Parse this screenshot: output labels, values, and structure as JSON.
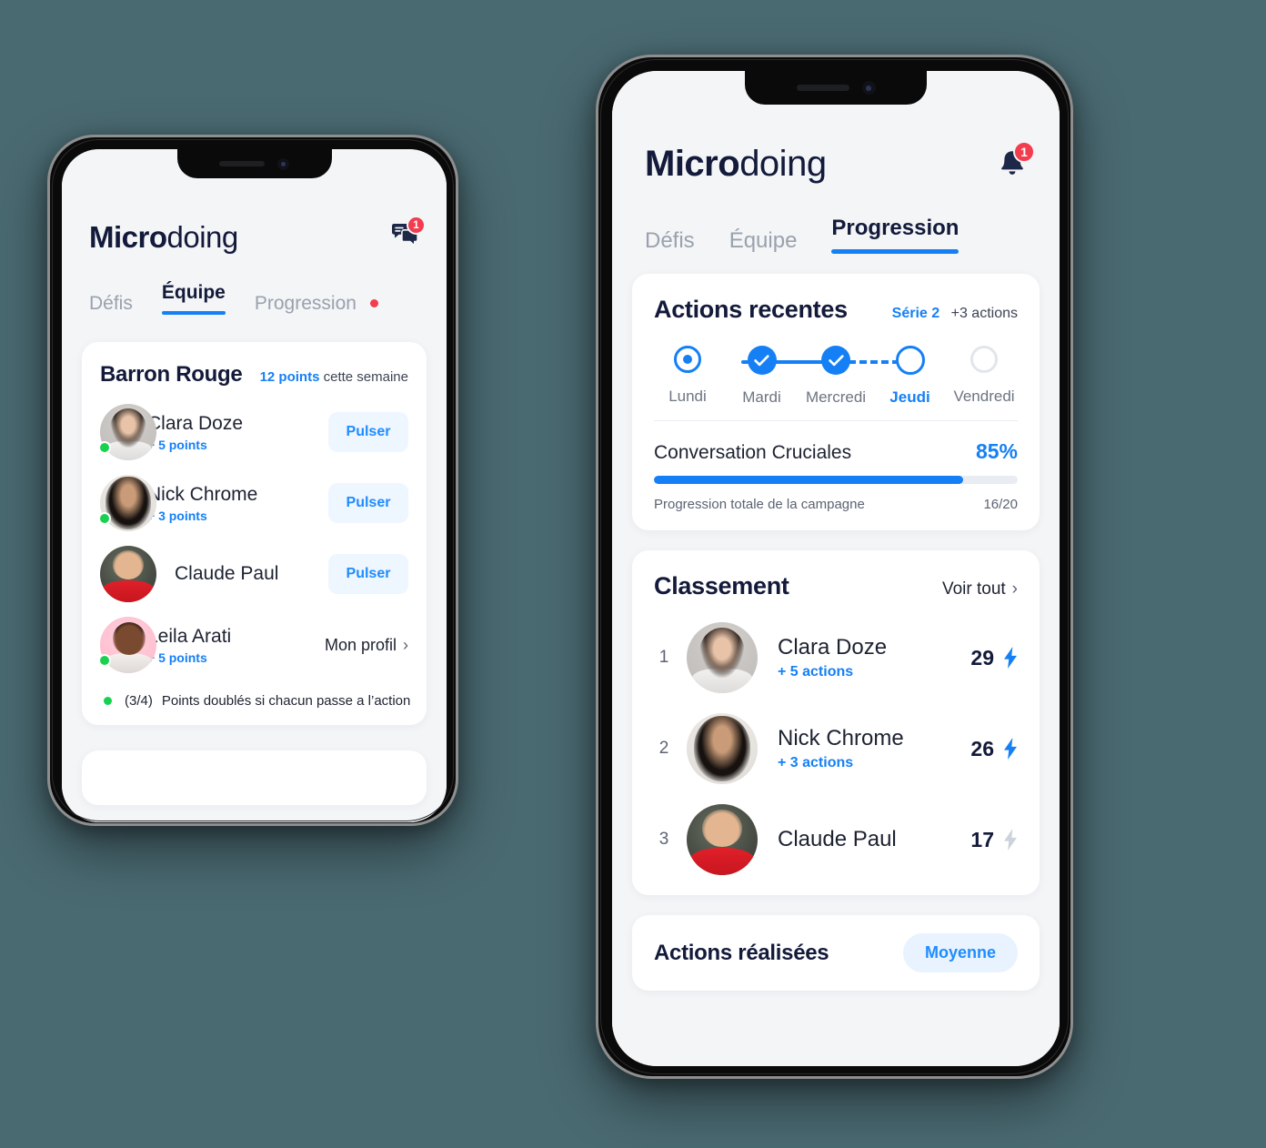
{
  "background_color": "#4a6a72",
  "brand": {
    "accent": "#1580f5",
    "dark": "#131a3a",
    "danger": "#f33c4e",
    "online": "#17d14f"
  },
  "phone_left": {
    "appbar": {
      "logo_bold": "Micro",
      "logo_light": "doing",
      "messages_icon": "chat-bubbles-icon",
      "messages_badge": "1"
    },
    "tabs": [
      {
        "label": "Défis",
        "active": false,
        "dot": false
      },
      {
        "label": "Équipe",
        "active": true,
        "dot": false
      },
      {
        "label": "Progression",
        "active": false,
        "dot": true
      }
    ],
    "team_card": {
      "title": "Barron Rouge",
      "points_value": "12 points",
      "points_suffix": "cette semaine",
      "members": [
        {
          "name": "Clara Doze",
          "sub": "+ 5 points",
          "online": true,
          "action": "Pulser",
          "action_type": "button",
          "avatar": "av-clara"
        },
        {
          "name": "Nick Chrome",
          "sub": "+ 3 points",
          "online": true,
          "action": "Pulser",
          "action_type": "button",
          "avatar": "av-nick"
        },
        {
          "name": "Claude Paul",
          "sub": "",
          "online": false,
          "action": "Pulser",
          "action_type": "button",
          "avatar": "av-claude"
        },
        {
          "name": "Leila Arati",
          "sub": "+ 5 points",
          "online": true,
          "action": "Mon profil",
          "action_type": "link",
          "avatar": "av-leila"
        }
      ],
      "footnote_count": "(3/4)",
      "footnote_text": "Points doublés si chacun passe a l’action"
    }
  },
  "phone_right": {
    "appbar": {
      "logo_bold": "Micro",
      "logo_light": "doing",
      "notifications_icon": "bell-icon",
      "notifications_badge": "1"
    },
    "tabs": [
      {
        "label": "Défis",
        "active": false
      },
      {
        "label": "Équipe",
        "active": false
      },
      {
        "label": "Progression",
        "active": true
      }
    ],
    "recent_actions": {
      "title": "Actions recentes",
      "streak_label": "Série 2",
      "streak_extra": "+3 actions",
      "days": [
        {
          "label": "Lundi",
          "state": "target",
          "current": false
        },
        {
          "label": "Mardi",
          "state": "done",
          "current": false
        },
        {
          "label": "Mercredi",
          "state": "done",
          "current": false
        },
        {
          "label": "Jeudi",
          "state": "open",
          "current": true
        },
        {
          "label": "Vendredi",
          "state": "empty",
          "current": false
        }
      ],
      "progress": {
        "label": "Conversation Cruciales",
        "percent_label": "85%",
        "percent_value": 85,
        "caption": "Progression totale de la campagne",
        "fraction": "16/20"
      }
    },
    "leaderboard": {
      "title": "Classement",
      "see_all": "Voir tout",
      "rows": [
        {
          "rank": "1",
          "name": "Clara Doze",
          "sub": "+ 5 actions",
          "points": "29",
          "bolt_active": true,
          "avatar": "av-clara"
        },
        {
          "rank": "2",
          "name": "Nick Chrome",
          "sub": "+ 3 actions",
          "points": "26",
          "bolt_active": true,
          "avatar": "av-nick"
        },
        {
          "rank": "3",
          "name": "Claude Paul",
          "sub": "",
          "points": "17",
          "bolt_active": false,
          "avatar": "av-claude"
        }
      ]
    },
    "completed_actions": {
      "title": "Actions réalisées",
      "chip": "Moyenne"
    }
  }
}
